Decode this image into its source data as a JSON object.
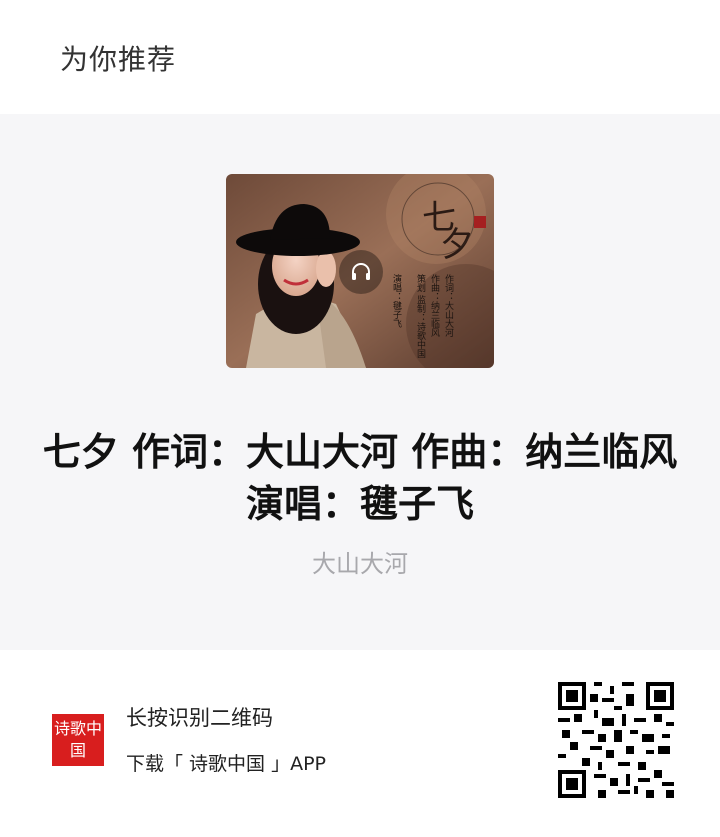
{
  "header": {
    "title": "为你推荐"
  },
  "card": {
    "cover": {
      "big_title": "七夕",
      "credits": {
        "line1": "作词：大山大河",
        "line2": "作曲：纳兰临风",
        "line3": "策划 监制：诗歌中国",
        "singer": "演唱：毽子飞"
      },
      "icon": "headphones-icon"
    },
    "song_title": "七夕 作词：大山大河 作曲：纳兰临风 演唱：毽子飞",
    "author": "大山大河"
  },
  "footer": {
    "logo_text": "诗歌中国",
    "hint_line1": "长按识别二维码",
    "hint_line2": "下载「 诗歌中国 」APP",
    "qr_icon": "qr-code-icon"
  },
  "colors": {
    "logo_red": "#d81e1e",
    "card_bg": "#f6f6f8",
    "muted_text": "#a8a8ac"
  }
}
